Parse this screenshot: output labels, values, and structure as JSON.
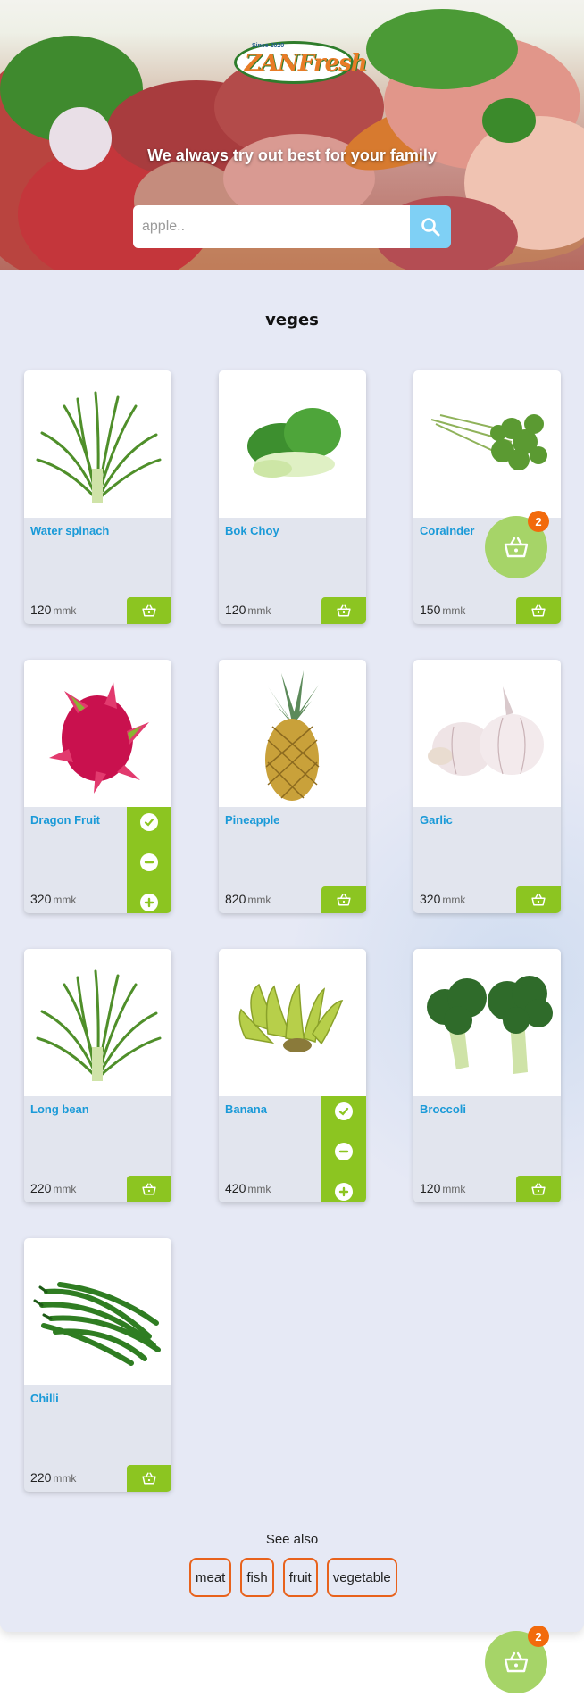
{
  "hero": {
    "logo_since": "Since 2020",
    "logo_brand": "ZANFresh",
    "tagline": "We always try out best for your family",
    "search_placeholder": "apple.."
  },
  "category": {
    "title": "veges"
  },
  "products": [
    {
      "name": "Water spinach",
      "price": "120",
      "unit": "mmk",
      "selected": false,
      "image": "water-spinach"
    },
    {
      "name": "Bok Choy",
      "price": "120",
      "unit": "mmk",
      "selected": false,
      "image": "bok-choy"
    },
    {
      "name": "Corainder",
      "price": "150",
      "unit": "mmk",
      "selected": false,
      "image": "coriander"
    },
    {
      "name": "Dragon Fruit",
      "price": "320",
      "unit": "mmk",
      "selected": true,
      "image": "dragon-fruit"
    },
    {
      "name": "Pineapple",
      "price": "820",
      "unit": "mmk",
      "selected": false,
      "image": "pineapple"
    },
    {
      "name": "Garlic",
      "price": "320",
      "unit": "mmk",
      "selected": false,
      "image": "garlic"
    },
    {
      "name": "Long bean",
      "price": "220",
      "unit": "mmk",
      "selected": false,
      "image": "long-bean"
    },
    {
      "name": "Banana",
      "price": "420",
      "unit": "mmk",
      "selected": true,
      "image": "banana"
    },
    {
      "name": "Broccoli",
      "price": "120",
      "unit": "mmk",
      "selected": false,
      "image": "broccoli"
    },
    {
      "name": "Chilli",
      "price": "220",
      "unit": "mmk",
      "selected": false,
      "image": "chilli"
    }
  ],
  "see_also": {
    "label": "See also",
    "tags": [
      "meat",
      "fish",
      "fruit",
      "vegetable"
    ]
  },
  "cart": {
    "count": "2"
  },
  "colors": {
    "accent_green": "#8cc521",
    "badge_orange": "#f26a0c",
    "product_name_blue": "#1a9ad8",
    "search_button": "#7fd0f5"
  }
}
